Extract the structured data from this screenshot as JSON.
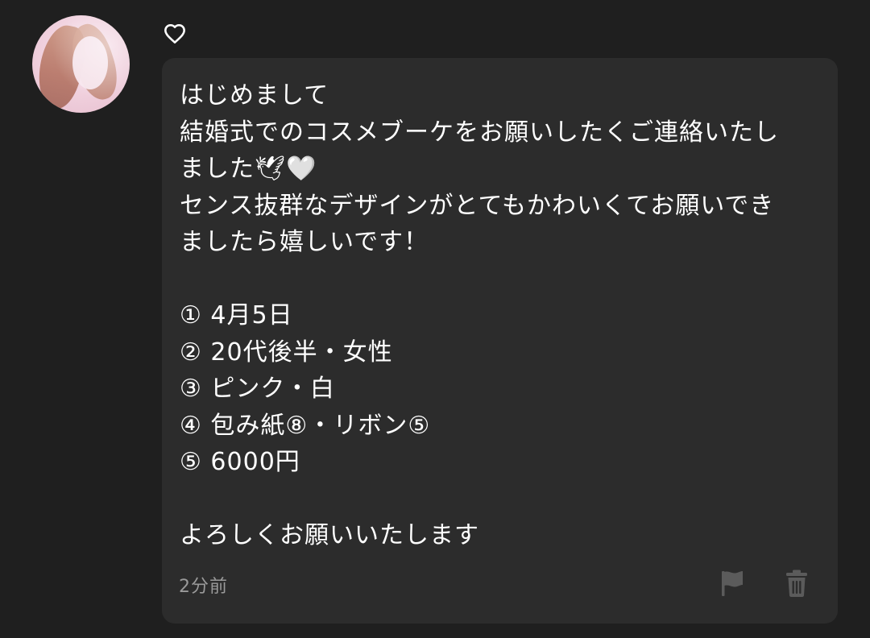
{
  "sender": {
    "avatar_icon": "user-avatar-photo"
  },
  "message": {
    "lines": [
      "はじめまして",
      "結婚式でのコスメブーケをお願いしたくご連絡いたし",
      "ました🕊🤍",
      "センス抜群なデザインがとてもかわいくてお願いでき",
      "ましたら嬉しいです！",
      "",
      "① 4月5日",
      "② 20代後半・女性",
      "③ ピンク・白",
      "④ 包み紙⑧・リボン⑤",
      "⑤ 6000円",
      "",
      "よろしくお願いいたします"
    ],
    "timestamp": "2分前"
  },
  "actions": {
    "like_icon": "heart-icon",
    "report_icon": "flag-icon",
    "delete_icon": "trash-icon"
  },
  "colors": {
    "background": "#1f1f1f",
    "bubble": "#2c2c2c",
    "text": "#ffffff",
    "muted": "#9a9a9a",
    "icon_muted": "#5b5b5b"
  }
}
